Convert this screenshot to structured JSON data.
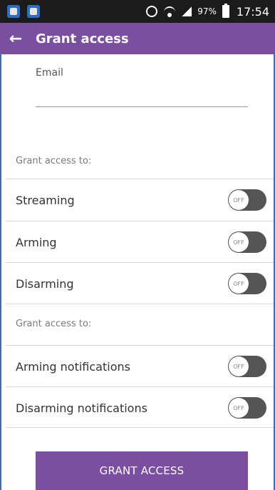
{
  "status_bar": {
    "battery_percent": "97%",
    "time": "17:54",
    "icons": [
      "app-notification-icon",
      "app-notification-icon",
      "alarm-icon",
      "wifi-icon",
      "signal-icon",
      "battery-icon"
    ]
  },
  "app_bar": {
    "back_icon": "←",
    "title": "Grant access"
  },
  "email": {
    "label": "Email",
    "value": "",
    "placeholder": ""
  },
  "sections": [
    {
      "heading": "Grant access to:",
      "items": [
        {
          "label": "Streaming",
          "state": "OFF"
        },
        {
          "label": "Arming",
          "state": "OFF"
        },
        {
          "label": "Disarming",
          "state": "OFF"
        }
      ]
    },
    {
      "heading": "Grant access to:",
      "items": [
        {
          "label": "Arming notifications",
          "state": "OFF"
        },
        {
          "label": "Disarming notifications",
          "state": "OFF"
        }
      ]
    }
  ],
  "grant_button": {
    "label": "GRANT ACCESS"
  },
  "colors": {
    "primary": "#7b4fa0",
    "status_bar": "#1b1b1b",
    "toggle_track_off": "#555555",
    "divider": "#d6d6d6"
  }
}
